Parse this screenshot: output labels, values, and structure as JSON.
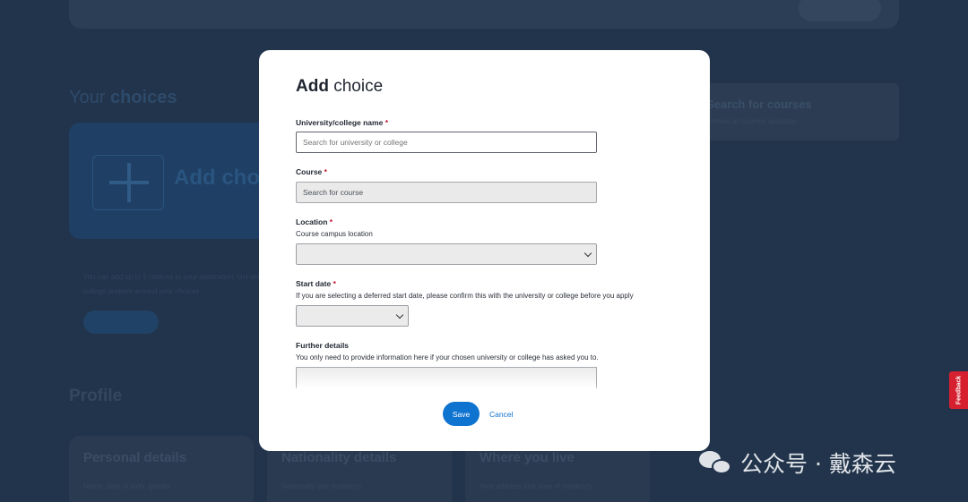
{
  "background": {
    "choices_title_light": "Your",
    "choices_title_bold": "choices",
    "add_choice_label": "Add cho",
    "info_text": "You can add up to 5 choices to your application. Uni and college prepare around your choices",
    "search_title": "Search for courses",
    "search_sub": "Browse all courses available",
    "profile_title": "Profile",
    "cards": [
      {
        "title": "Personal details",
        "sub": "Name, date of birth, gender"
      },
      {
        "title": "Nationality details",
        "sub": "Nationality and residency"
      },
      {
        "title": "Where you live",
        "sub": "Your address and area of residency"
      }
    ]
  },
  "modal": {
    "title_bold": "Add",
    "title_rest": " choice",
    "university": {
      "label": "University/college name",
      "required": "*",
      "placeholder": "Search for university or college"
    },
    "course": {
      "label": "Course",
      "required": "*",
      "value": "Search for course"
    },
    "location": {
      "label": "Location",
      "required": "*",
      "hint": "Course campus location",
      "value": ""
    },
    "start_date": {
      "label": "Start date",
      "required": "*",
      "hint": "If you are selecting a deferred start date, please confirm this with the university or college before you apply",
      "value": ""
    },
    "further_details": {
      "label": "Further details",
      "hint": "You only need to provide information here if your chosen university or college has asked you to."
    },
    "save_label": "Save",
    "cancel_label": "Cancel"
  },
  "feedback_label": "Feedback",
  "watermark": "公众号 · 戴森云",
  "colors": {
    "primary": "#0f73d0",
    "required": "#c4142b",
    "feedback": "#d6202f",
    "overlay": "#22344b"
  }
}
